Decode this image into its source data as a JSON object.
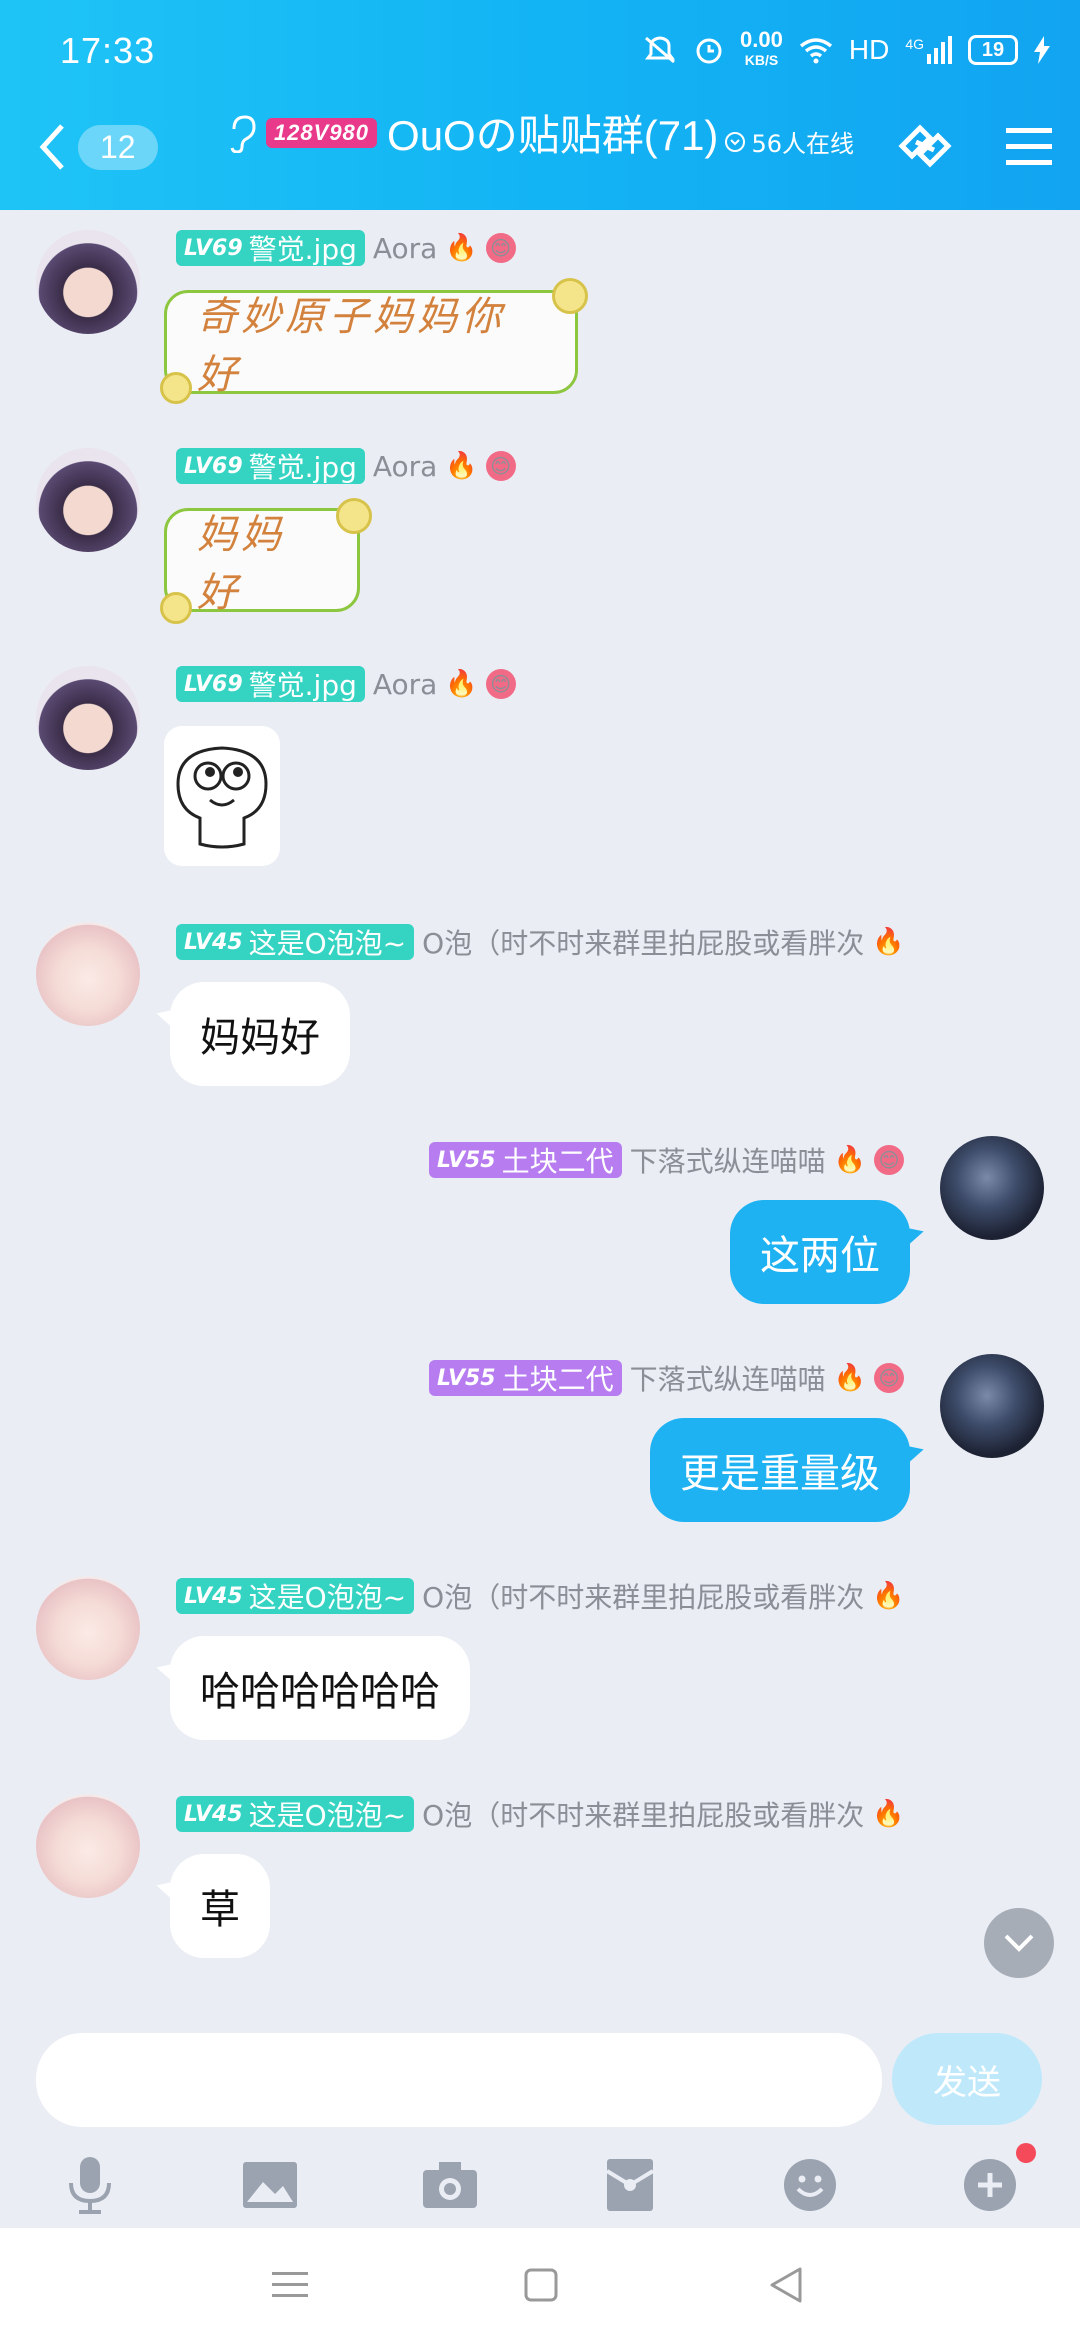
{
  "status_bar": {
    "time": "17:33",
    "net_speed": "0.00",
    "net_unit": "KB/S",
    "hd": "HD",
    "signal": "4G",
    "battery": "19"
  },
  "header": {
    "back_count": "12",
    "title_tag": "128V980",
    "title": "OuOの贴贴群(71)",
    "online": "56人在线"
  },
  "messages": [
    {
      "level": "LV69",
      "title": "警觉.jpg",
      "name": "Aora",
      "content": "奇妙原子妈妈你好",
      "type": "flower"
    },
    {
      "level": "LV69",
      "title": "警觉.jpg",
      "name": "Aora",
      "content": "妈妈好",
      "type": "flower"
    },
    {
      "level": "LV69",
      "title": "警觉.jpg",
      "name": "Aora",
      "type": "sticker"
    },
    {
      "level": "LV45",
      "title": "这是O泡泡~",
      "name": "O泡（时不时来群里拍屁股或看胖次",
      "content": "妈妈好",
      "type": "text"
    },
    {
      "level": "LV55",
      "title": "土块二代",
      "name": "下落式纵连喵喵",
      "content": "这两位",
      "type": "self"
    },
    {
      "level": "LV55",
      "title": "土块二代",
      "name": "下落式纵连喵喵",
      "content": "更是重量级",
      "type": "self"
    },
    {
      "level": "LV45",
      "title": "这是O泡泡~",
      "name": "O泡（时不时来群里拍屁股或看胖次",
      "content": "哈哈哈哈哈哈",
      "type": "text"
    },
    {
      "level": "LV45",
      "title": "这是O泡泡~",
      "name": "O泡（时不时来群里拍屁股或看胖次",
      "content": "草",
      "type": "text"
    }
  ],
  "input": {
    "send_label": "发送",
    "placeholder": ""
  },
  "colors": {
    "header": "#13b4f4",
    "self_bubble": "#1fb2f3",
    "lv_teal": "#35d3c2",
    "lv_purple": "#b77df0",
    "background": "#eaedf4"
  },
  "toolbar_icons": [
    "microphone-icon",
    "image-icon",
    "camera-icon",
    "red-packet-icon",
    "emoji-icon",
    "plus-icon"
  ]
}
